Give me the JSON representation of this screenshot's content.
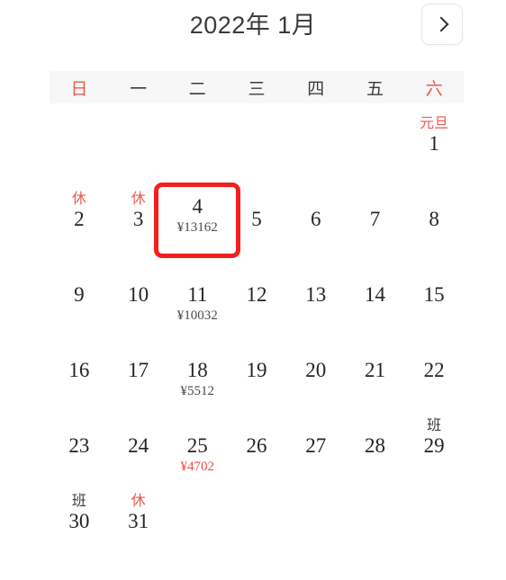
{
  "header": {
    "month_title": "2022年 1月",
    "next_button_icon": "chevron-right-icon",
    "next_button_label": ">"
  },
  "weekdays": [
    {
      "label": "日",
      "weekend": true
    },
    {
      "label": "一",
      "weekend": false
    },
    {
      "label": "二",
      "weekend": false
    },
    {
      "label": "三",
      "weekend": false
    },
    {
      "label": "四",
      "weekend": false
    },
    {
      "label": "五",
      "weekend": false
    },
    {
      "label": "六",
      "weekend": true
    }
  ],
  "colors": {
    "accent_red": "#ea5a4e",
    "selection_red": "#f21f1f",
    "low_price_red": "#ee4d44",
    "day_text": "#24242a",
    "weekbar_bg": "#f7f7f7",
    "title_text": "#3a3a3c"
  },
  "legend": {
    "rest_badge": "休",
    "work_badge": "班",
    "festival_badge": "元旦"
  },
  "selected_day": 4,
  "weeks": [
    [
      {
        "day": "",
        "badge": "",
        "badge_type": "",
        "price": "",
        "price_low": false,
        "empty": true
      },
      {
        "day": "",
        "badge": "",
        "badge_type": "",
        "price": "",
        "price_low": false,
        "empty": true
      },
      {
        "day": "",
        "badge": "",
        "badge_type": "",
        "price": "",
        "price_low": false,
        "empty": true
      },
      {
        "day": "",
        "badge": "",
        "badge_type": "",
        "price": "",
        "price_low": false,
        "empty": true
      },
      {
        "day": "",
        "badge": "",
        "badge_type": "",
        "price": "",
        "price_low": false,
        "empty": true
      },
      {
        "day": "",
        "badge": "",
        "badge_type": "",
        "price": "",
        "price_low": false,
        "empty": true
      },
      {
        "day": "1",
        "badge": "元旦",
        "badge_type": "festival",
        "price": "",
        "price_low": false,
        "empty": false
      }
    ],
    [
      {
        "day": "2",
        "badge": "休",
        "badge_type": "rest",
        "price": "",
        "price_low": false,
        "empty": false
      },
      {
        "day": "3",
        "badge": "休",
        "badge_type": "rest",
        "price": "",
        "price_low": false,
        "empty": false
      },
      {
        "day": "4",
        "badge": "",
        "badge_type": "",
        "price": "¥13162",
        "price_low": false,
        "empty": false,
        "selected": true
      },
      {
        "day": "5",
        "badge": "",
        "badge_type": "",
        "price": "",
        "price_low": false,
        "empty": false
      },
      {
        "day": "6",
        "badge": "",
        "badge_type": "",
        "price": "",
        "price_low": false,
        "empty": false
      },
      {
        "day": "7",
        "badge": "",
        "badge_type": "",
        "price": "",
        "price_low": false,
        "empty": false
      },
      {
        "day": "8",
        "badge": "",
        "badge_type": "",
        "price": "",
        "price_low": false,
        "empty": false
      }
    ],
    [
      {
        "day": "9",
        "badge": "",
        "badge_type": "",
        "price": "",
        "price_low": false,
        "empty": false
      },
      {
        "day": "10",
        "badge": "",
        "badge_type": "",
        "price": "",
        "price_low": false,
        "empty": false
      },
      {
        "day": "11",
        "badge": "",
        "badge_type": "",
        "price": "¥10032",
        "price_low": false,
        "empty": false
      },
      {
        "day": "12",
        "badge": "",
        "badge_type": "",
        "price": "",
        "price_low": false,
        "empty": false
      },
      {
        "day": "13",
        "badge": "",
        "badge_type": "",
        "price": "",
        "price_low": false,
        "empty": false
      },
      {
        "day": "14",
        "badge": "",
        "badge_type": "",
        "price": "",
        "price_low": false,
        "empty": false
      },
      {
        "day": "15",
        "badge": "",
        "badge_type": "",
        "price": "",
        "price_low": false,
        "empty": false
      }
    ],
    [
      {
        "day": "16",
        "badge": "",
        "badge_type": "",
        "price": "",
        "price_low": false,
        "empty": false
      },
      {
        "day": "17",
        "badge": "",
        "badge_type": "",
        "price": "",
        "price_low": false,
        "empty": false
      },
      {
        "day": "18",
        "badge": "",
        "badge_type": "",
        "price": "¥5512",
        "price_low": false,
        "empty": false
      },
      {
        "day": "19",
        "badge": "",
        "badge_type": "",
        "price": "",
        "price_low": false,
        "empty": false
      },
      {
        "day": "20",
        "badge": "",
        "badge_type": "",
        "price": "",
        "price_low": false,
        "empty": false
      },
      {
        "day": "21",
        "badge": "",
        "badge_type": "",
        "price": "",
        "price_low": false,
        "empty": false
      },
      {
        "day": "22",
        "badge": "",
        "badge_type": "",
        "price": "",
        "price_low": false,
        "empty": false
      }
    ],
    [
      {
        "day": "23",
        "badge": "",
        "badge_type": "",
        "price": "",
        "price_low": false,
        "empty": false
      },
      {
        "day": "24",
        "badge": "",
        "badge_type": "",
        "price": "",
        "price_low": false,
        "empty": false
      },
      {
        "day": "25",
        "badge": "",
        "badge_type": "",
        "price": "¥4702",
        "price_low": true,
        "empty": false
      },
      {
        "day": "26",
        "badge": "",
        "badge_type": "",
        "price": "",
        "price_low": false,
        "empty": false
      },
      {
        "day": "27",
        "badge": "",
        "badge_type": "",
        "price": "",
        "price_low": false,
        "empty": false
      },
      {
        "day": "28",
        "badge": "",
        "badge_type": "",
        "price": "",
        "price_low": false,
        "empty": false
      },
      {
        "day": "29",
        "badge": "班",
        "badge_type": "work",
        "price": "",
        "price_low": false,
        "empty": false
      }
    ],
    [
      {
        "day": "30",
        "badge": "班",
        "badge_type": "work",
        "price": "",
        "price_low": false,
        "empty": false
      },
      {
        "day": "31",
        "badge": "休",
        "badge_type": "rest",
        "price": "",
        "price_low": false,
        "empty": false
      },
      {
        "day": "",
        "badge": "",
        "badge_type": "",
        "price": "",
        "price_low": false,
        "empty": true
      },
      {
        "day": "",
        "badge": "",
        "badge_type": "",
        "price": "",
        "price_low": false,
        "empty": true
      },
      {
        "day": "",
        "badge": "",
        "badge_type": "",
        "price": "",
        "price_low": false,
        "empty": true
      },
      {
        "day": "",
        "badge": "",
        "badge_type": "",
        "price": "",
        "price_low": false,
        "empty": true
      },
      {
        "day": "",
        "badge": "",
        "badge_type": "",
        "price": "",
        "price_low": false,
        "empty": true
      }
    ]
  ]
}
